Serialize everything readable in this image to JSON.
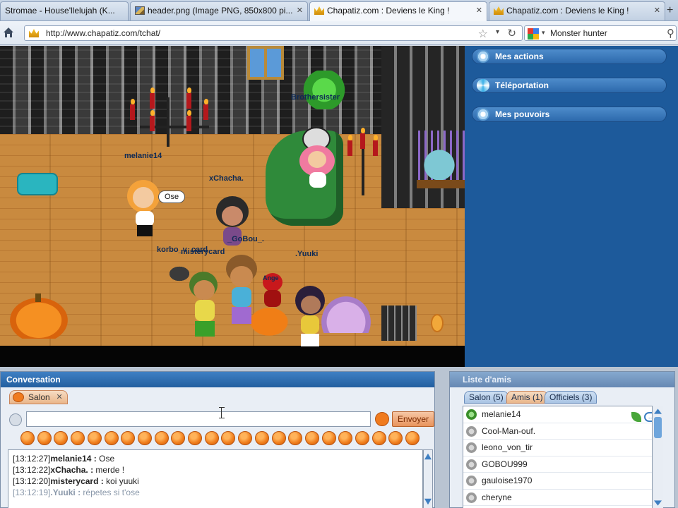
{
  "browser": {
    "tabs": [
      {
        "title": "Stromae - House'llelujah (K...",
        "icon": "music-icon"
      },
      {
        "title": "header.png (Image PNG, 850x800 pi...",
        "icon": "image-icon"
      },
      {
        "title": "Chapatiz.com : Deviens le King !",
        "icon": "crown-icon",
        "active": true
      },
      {
        "title": "Chapatiz.com : Deviens le King !",
        "icon": "crown-icon"
      }
    ],
    "new_tab_label": "+",
    "url": "http://www.chapatiz.com/tchat/",
    "search_value": "Monster hunter"
  },
  "scene": {
    "pseudos": {
      "melanie": "melanie14",
      "brothers": "Brothersister",
      "chacha": "xChacha.",
      "korbo": "korbo_v_card",
      "mistery": "misterycard",
      "gobou": "_GoBou_.",
      "yuuki": ".Yuuki",
      "ange": "Ange"
    },
    "bubble_text": "Ose"
  },
  "side_panel": {
    "buttons": [
      {
        "label": "Mes actions",
        "icon": "gear-icon"
      },
      {
        "label": "Téléportation",
        "icon": "teleport-icon"
      },
      {
        "label": "Mes pouvoirs",
        "icon": "gear-icon"
      }
    ]
  },
  "conversation": {
    "title": "Conversation",
    "tab_label": "Salon",
    "input_value": "",
    "send_label": "Envoyer",
    "messages": [
      {
        "time": "[13:12:27]",
        "nick": "melanie14 :",
        "text": "Ose"
      },
      {
        "time": "[13:12:22]",
        "nick": "xChacha. :",
        "text": "merde !"
      },
      {
        "time": "[13:12:20]",
        "nick": "misterycard :",
        "text": "koi yuuki"
      },
      {
        "time": "[13:12:19]",
        "nick": ".Yuuki :",
        "text": "répetes si t'ose",
        "faded": true
      }
    ]
  },
  "friends": {
    "title": "Liste d'amis",
    "tabs": [
      {
        "label": "Salon (5)"
      },
      {
        "label": "Amis (1)",
        "active": true
      },
      {
        "label": "Officiels (3)"
      }
    ],
    "list": [
      {
        "name": "melanie14",
        "online": true
      },
      {
        "name": "Cool-Man-ouf.",
        "online": false
      },
      {
        "name": "leono_von_tir",
        "online": false
      },
      {
        "name": "GOBOU999",
        "online": false
      },
      {
        "name": "gauloise1970",
        "online": false
      },
      {
        "name": "cheryne",
        "online": false
      }
    ]
  },
  "colors": {
    "panel_blue": "#1d5a9b",
    "accent_orange": "#f07b1e",
    "header_blue": "#235f9f"
  }
}
